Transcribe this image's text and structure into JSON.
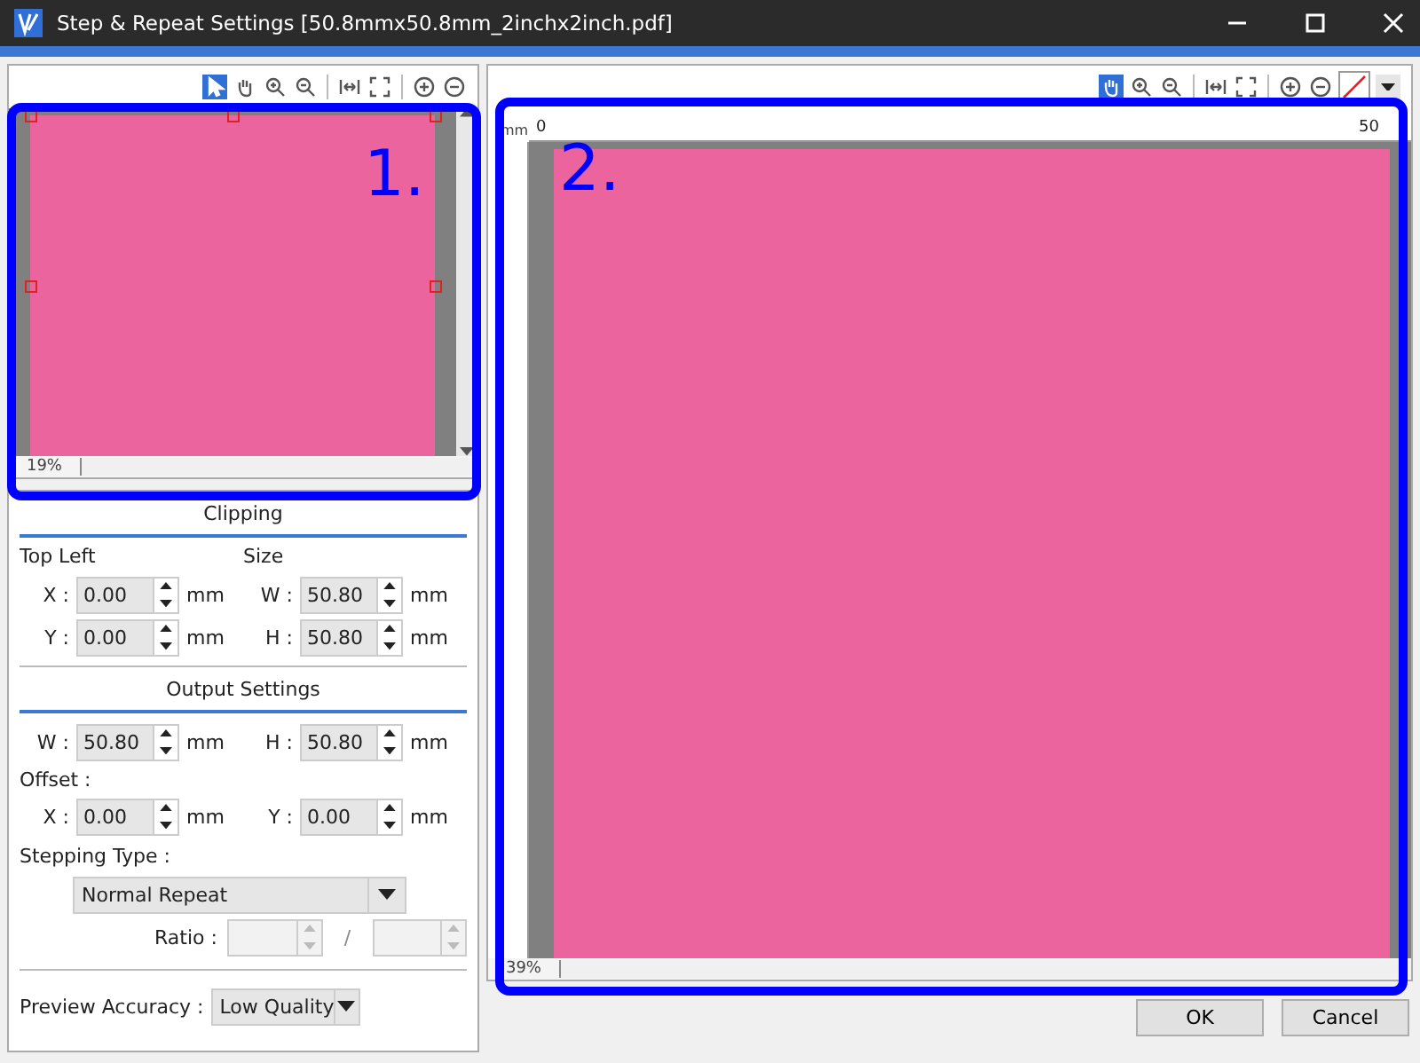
{
  "window": {
    "title": "Step & Repeat Settings [50.8mmx50.8mm_2inchx2inch.pdf]"
  },
  "left_toolbar": {
    "tools": [
      {
        "kind": "pointer",
        "selected": true
      },
      {
        "kind": "hand",
        "selected": false
      },
      {
        "kind": "zoom-in",
        "selected": false
      },
      {
        "kind": "zoom-out",
        "selected": false
      },
      {
        "kind": "fit-width",
        "selected": false
      },
      {
        "kind": "fit-page",
        "selected": false
      },
      {
        "kind": "plus",
        "selected": false
      },
      {
        "kind": "minus",
        "selected": false
      }
    ]
  },
  "preview": {
    "zoom": "19%"
  },
  "clipping": {
    "title": "Clipping",
    "top_left_label": "Top Left",
    "size_label": "Size",
    "rows": [
      [
        {
          "label": "X :",
          "value": "0.00",
          "unit": "mm"
        },
        {
          "label": "W :",
          "value": "50.80",
          "unit": "mm"
        }
      ],
      [
        {
          "label": "Y :",
          "value": "0.00",
          "unit": "mm"
        },
        {
          "label": "H :",
          "value": "50.80",
          "unit": "mm"
        }
      ]
    ]
  },
  "output": {
    "title": "Output Settings",
    "size_row": [
      {
        "label": "W :",
        "value": "50.80",
        "unit": "mm"
      },
      {
        "label": "H :",
        "value": "50.80",
        "unit": "mm"
      }
    ],
    "offset_label": "Offset :",
    "offset_row": [
      {
        "label": "X :",
        "value": "0.00",
        "unit": "mm"
      },
      {
        "label": "Y :",
        "value": "0.00",
        "unit": "mm"
      }
    ],
    "stepping_label": "Stepping Type :",
    "stepping_value": "Normal Repeat",
    "ratio_label": "Ratio :",
    "ratio_separator": "/"
  },
  "preview_accuracy": {
    "label": "Preview Accuracy :",
    "value": "Low Quality"
  },
  "right_toolbar": {
    "tools": [
      {
        "kind": "hand",
        "selected": true
      },
      {
        "kind": "zoom-in",
        "selected": false
      },
      {
        "kind": "zoom-out",
        "selected": false
      },
      {
        "kind": "fit-width",
        "selected": false
      },
      {
        "kind": "fit-page",
        "selected": false
      },
      {
        "kind": "plus",
        "selected": false
      },
      {
        "kind": "minus",
        "selected": false
      }
    ]
  },
  "main_view": {
    "ruler_unit": "mm",
    "ruler_start": "0",
    "ruler_end": "50",
    "zoom": "39%"
  },
  "buttons": [
    "OK",
    "Cancel"
  ],
  "annotations": [
    {
      "label": "1."
    },
    {
      "label": "2."
    }
  ]
}
